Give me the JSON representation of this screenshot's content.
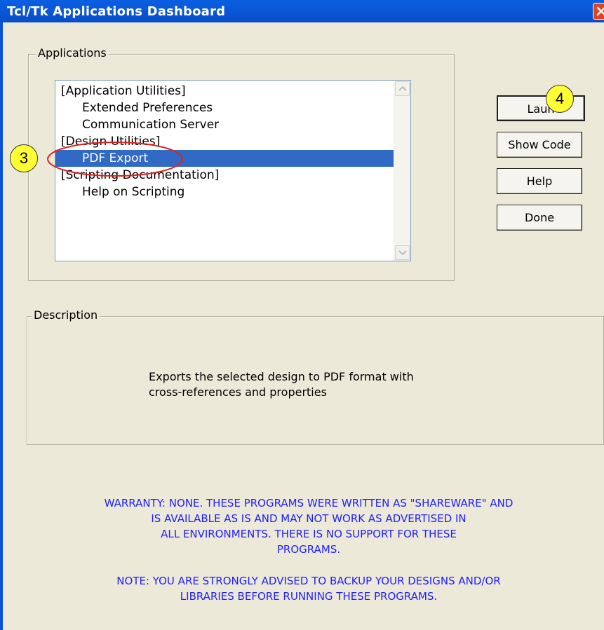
{
  "window": {
    "title": "Tcl/Tk Applications Dashboard"
  },
  "applications": {
    "group_label": "Applications",
    "items": [
      {
        "label": "[Application Utilities]",
        "type": "category"
      },
      {
        "label": "Extended Preferences",
        "type": "item"
      },
      {
        "label": "Communication Server",
        "type": "item"
      },
      {
        "label": "[Design Utilities]",
        "type": "category"
      },
      {
        "label": "PDF Export",
        "type": "item",
        "selected": true
      },
      {
        "label": "[Scripting Documentation]",
        "type": "category"
      },
      {
        "label": "Help on Scripting",
        "type": "item"
      }
    ]
  },
  "buttons": {
    "launch": "Laun",
    "show_code": "Show Code",
    "help": "Help",
    "done": "Done"
  },
  "callouts": {
    "three": "3",
    "four": "4"
  },
  "description": {
    "group_label": "Description",
    "line1": "Exports the selected design to PDF format with",
    "line2": "cross-references and properties"
  },
  "warning": {
    "line1": "WARRANTY: NONE. THESE PROGRAMS WERE WRITTEN AS \"SHAREWARE\" AND",
    "line2": "IS AVAILABLE AS IS AND MAY NOT WORK AS ADVERTISED IN",
    "line3": "ALL ENVIRONMENTS. THERE IS NO SUPPORT FOR THESE",
    "line4": "PROGRAMS."
  },
  "note": {
    "line1": "NOTE: YOU ARE STRONGLY ADVISED TO BACKUP YOUR DESIGNS AND/OR",
    "line2": "LIBRARIES BEFORE RUNNING THESE PROGRAMS."
  },
  "colors": {
    "titlebar": "#0A5FE0",
    "selection": "#316AC5",
    "warning_text": "#2020FF",
    "callout_fill": "#FFFF33",
    "annotation_ellipse": "#E0201E"
  }
}
